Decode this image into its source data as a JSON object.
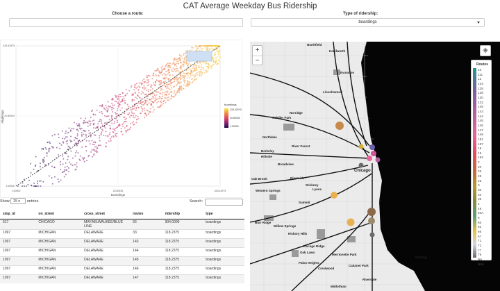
{
  "app": {
    "title": "CAT Average Weekday Bus Ridership"
  },
  "controls": {
    "route_label": "Choose a route:",
    "type_label": "Type of ridership:",
    "type_value": "boardings"
  },
  "scatter": {
    "xlabel": "Boardings",
    "ylabel": "Alightings",
    "x_ticks": [
      "1.00000",
      "20.80034",
      "433.42979"
    ],
    "y_ticks": [
      "1.00000",
      "20.80034",
      "433.42979"
    ],
    "colorbar_title": "boardings",
    "colorbar_ticks": [
      "433.42979",
      "20.80034",
      "1.00000"
    ]
  },
  "chart_data": {
    "type": "scatter",
    "xlabel": "Boardings",
    "ylabel": "Alightings",
    "scale": "log",
    "xlim": [
      1,
      433.42979
    ],
    "ylim": [
      1,
      433.42979
    ],
    "legend_title": "boardings",
    "colors": [
      "#1a0d3d",
      "#5c1c6e",
      "#c8336c",
      "#ef7a44",
      "#f7d84a"
    ]
  },
  "table_controls": {
    "show": "Show",
    "length": "25",
    "entries": "entries",
    "search": "Search:"
  },
  "table": {
    "columns": [
      "stop_id",
      "on_street",
      "cross_street",
      "routes",
      "ridership",
      "type"
    ],
    "rows": [
      [
        "617",
        "CHICAGO",
        "MAY/MILWAUKEE/BLUE LINE",
        "66",
        "904.0000",
        "boardings"
      ],
      [
        "1097",
        "MICHIGAN",
        "DELAWARE",
        "33",
        "118.2375",
        "boardings"
      ],
      [
        "1097",
        "MICHIGAN",
        "DELAWARE",
        "143",
        "118.2375",
        "boardings"
      ],
      [
        "1097",
        "MICHIGAN",
        "DELAWARE",
        "144",
        "118.2375",
        "boardings"
      ],
      [
        "1097",
        "MICHIGAN",
        "DELAWARE",
        "145",
        "118.2375",
        "boardings"
      ],
      [
        "1097",
        "MICHIGAN",
        "DELAWARE",
        "146",
        "118.2375",
        "boardings"
      ],
      [
        "1097",
        "MICHIGAN",
        "DELAWARE",
        "147",
        "118.2375",
        "boardings"
      ]
    ]
  },
  "map": {
    "labels": [
      "Northfield",
      "Kenilworth",
      "Evanston",
      "Lincolnwood",
      "Norridge",
      "Schiller Park",
      "Northlake",
      "River Forest",
      "Berkeley",
      "Hillside",
      "Broadview",
      "Chicago",
      "Oak Brook",
      "Riverside",
      "Stickney",
      "Western Springs",
      "Lyons",
      "Summit",
      "Burr Ridge",
      "Willow Springs",
      "Hickory Hills",
      "Chicago Ridge",
      "Oak Lawn",
      "Palos Heights",
      "Crestwood",
      "Merrionette Park",
      "Calumet Park",
      "Riverdale",
      "Whiting",
      "Midlothian"
    ],
    "zoom_in": "+",
    "zoom_out": "−"
  },
  "legend": {
    "title": "Routes",
    "items": [
      "10",
      "111",
      "12",
      "124",
      "125",
      "128",
      "130",
      "132",
      "135",
      "143",
      "144",
      "145",
      "146",
      "147",
      "148",
      "151",
      "157",
      "18",
      "19",
      "192",
      "2",
      "20",
      "26",
      "28",
      "29",
      "3",
      "30",
      "33",
      "36",
      "4",
      "49",
      "53A",
      "6",
      "60",
      "62",
      "66",
      "67",
      "71",
      "72",
      "77",
      "79",
      "N5",
      "N66"
    ]
  }
}
